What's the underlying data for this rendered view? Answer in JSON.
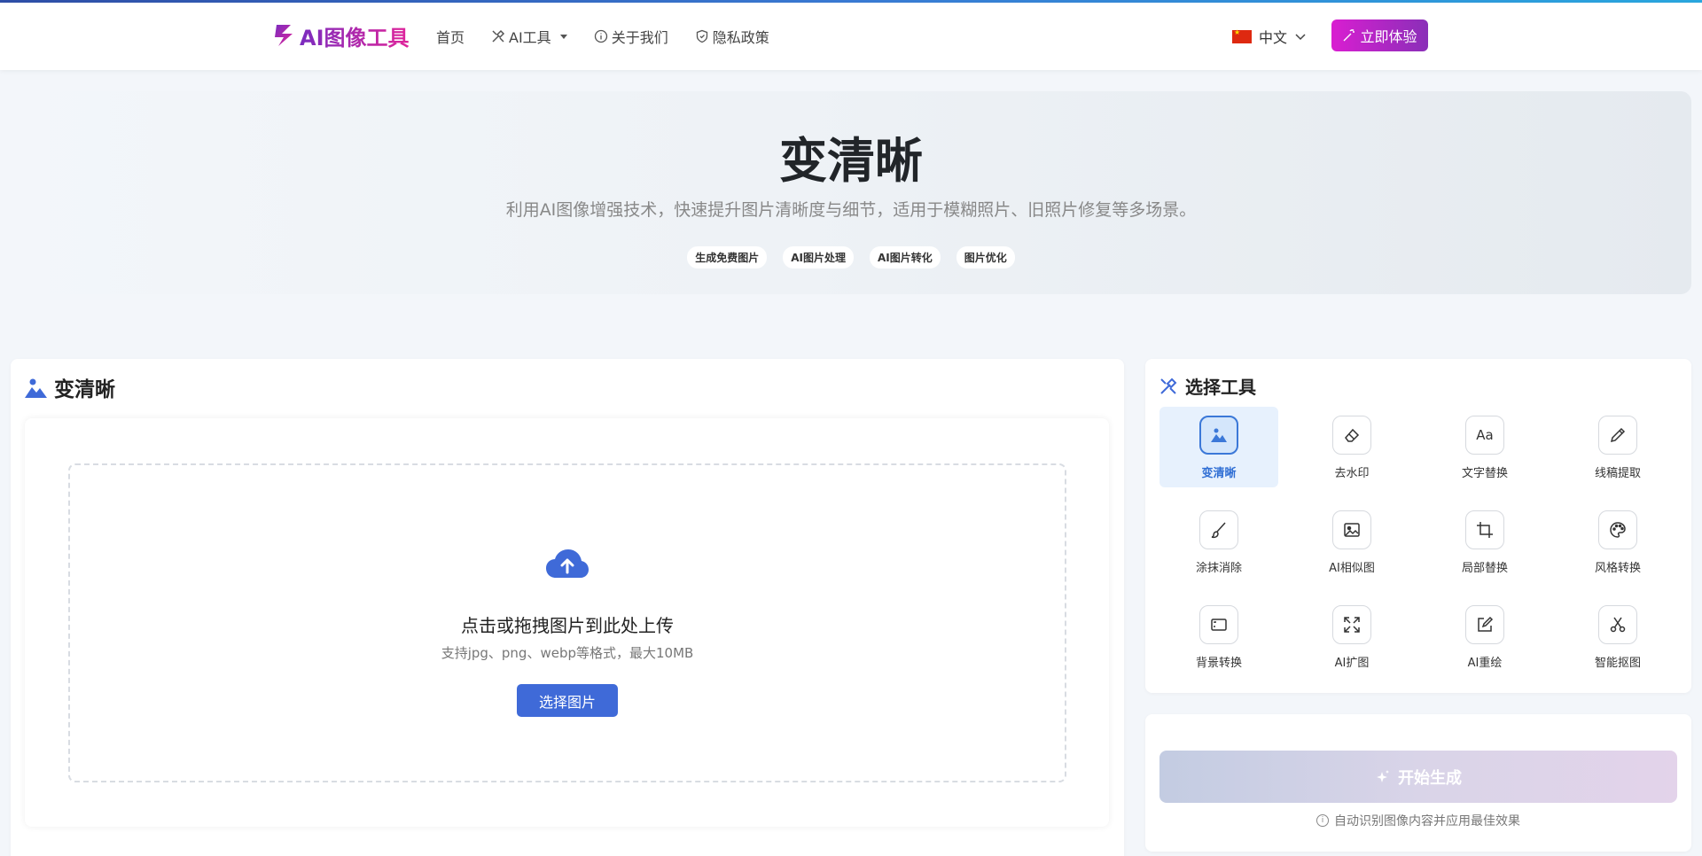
{
  "brand": {
    "name": "AI图像工具"
  },
  "nav": {
    "home": "首页",
    "ai_tools": "AI工具",
    "about": "关于我们",
    "privacy": "隐私政策"
  },
  "lang": {
    "label": "中文"
  },
  "cta": {
    "label": "立即体验"
  },
  "hero": {
    "title": "变清晰",
    "subtitle": "利用AI图像增强技术，快速提升图片清晰度与细节，适用于模糊照片、旧照片修复等多场景。",
    "tags": [
      "生成免费图片",
      "AI图片处理",
      "AI图片转化",
      "图片优化"
    ]
  },
  "upload_panel": {
    "title": "变清晰",
    "dropzone_title": "点击或拖拽图片到此处上传",
    "dropzone_hint": "支持jpg、png、webp等格式，最大10MB",
    "choose_button": "选择图片"
  },
  "tools": {
    "title": "选择工具",
    "items": [
      {
        "label": "变清晰",
        "icon": "image-icon",
        "active": true
      },
      {
        "label": "去水印",
        "icon": "eraser-icon",
        "active": false
      },
      {
        "label": "文字替换",
        "icon": "text-icon",
        "active": false
      },
      {
        "label": "线稿提取",
        "icon": "pencil-icon",
        "active": false
      },
      {
        "label": "涂抹消除",
        "icon": "brush-icon",
        "active": false
      },
      {
        "label": "AI相似图",
        "icon": "images-icon",
        "active": false
      },
      {
        "label": "局部替换",
        "icon": "crop-icon",
        "active": false
      },
      {
        "label": "风格转换",
        "icon": "palette-icon",
        "active": false
      },
      {
        "label": "背景转换",
        "icon": "frame-icon",
        "active": false
      },
      {
        "label": "AI扩图",
        "icon": "expand-icon",
        "active": false
      },
      {
        "label": "AI重绘",
        "icon": "edit-icon",
        "active": false
      },
      {
        "label": "智能抠图",
        "icon": "scissors-icon",
        "active": false
      }
    ]
  },
  "generate": {
    "button": "开始生成",
    "hint": "自动识别图像内容并应用最佳效果"
  },
  "colors": {
    "accent": "#3f6ad8",
    "brand_gradient_start": "#d91ed1",
    "brand_gradient_end": "#8a2fb8"
  }
}
